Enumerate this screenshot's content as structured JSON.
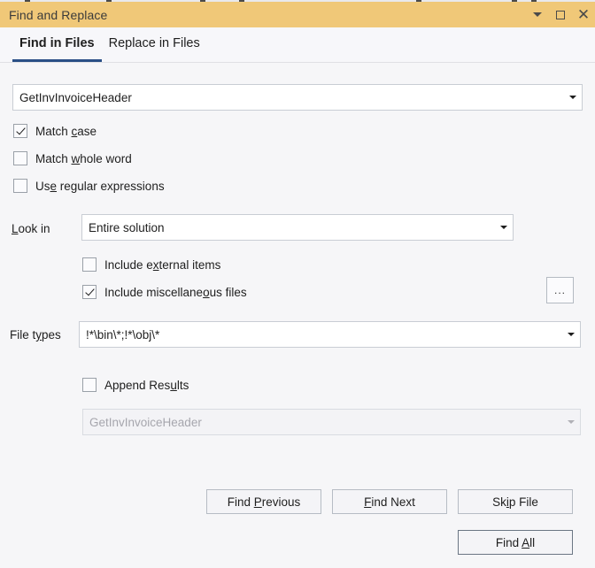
{
  "window": {
    "title": "Find and Replace",
    "controls": [
      {
        "name": "window-dropdown-icon",
        "glyph": "chevron-down-icon"
      },
      {
        "name": "window-restore-icon",
        "glyph": "restore-square-icon"
      },
      {
        "name": "window-close-icon",
        "glyph": "close-x-icon",
        "label": "✕"
      }
    ]
  },
  "tabs": [
    {
      "label": "Find in Files",
      "active": true
    },
    {
      "label": "Replace in Files",
      "active": false
    }
  ],
  "search": {
    "value": "GetInvInvoiceHeader",
    "dropdown_icon": "chevron-down-icon"
  },
  "options": [
    {
      "pre": "Match ",
      "accel": "c",
      "post": "ase",
      "checked": true
    },
    {
      "pre": "Match ",
      "accel": "w",
      "post": "hole word",
      "checked": false
    },
    {
      "pre": "Us",
      "accel": "e",
      "post": " regular expressions",
      "checked": false
    }
  ],
  "look_in": {
    "label_pre": "",
    "label_accel": "L",
    "label_post": "ook in",
    "value": "Entire solution",
    "browse_label": "...",
    "dropdown_icon": "chevron-down-icon"
  },
  "include_options": [
    {
      "pre": "Include e",
      "accel": "x",
      "post": "ternal items",
      "checked": false
    },
    {
      "pre": "Include miscellane",
      "accel": "o",
      "post": "us files",
      "checked": true
    }
  ],
  "file_types": {
    "label_pre": "File t",
    "label_accel": "y",
    "label_post": "pes",
    "value": "!*\\bin\\*;!*\\obj\\*",
    "dropdown_icon": "chevron-down-icon"
  },
  "append": {
    "pre": "Append Res",
    "accel": "u",
    "post": "lts",
    "checked": false
  },
  "replace_field": {
    "value": "GetInvInvoiceHeader",
    "enabled": false,
    "dropdown_icon": "chevron-down-icon"
  },
  "buttons": [
    {
      "pre": "Find ",
      "accel": "P",
      "post": "revious",
      "default": false
    },
    {
      "pre": "",
      "accel": "F",
      "post": "ind Next",
      "default": false
    },
    {
      "pre": "Sk",
      "accel": "i",
      "post": "p File",
      "default": false
    },
    {
      "pre": "Find ",
      "accel": "A",
      "post": "ll",
      "default": true
    }
  ],
  "colors": {
    "titlebar": "#f0c878",
    "tab_underline": "#2a4f86",
    "body_bg": "#f6f6f8",
    "field_border": "#c9cdd4",
    "button_border": "#b6bcc4",
    "default_button_border": "#6b7684"
  }
}
